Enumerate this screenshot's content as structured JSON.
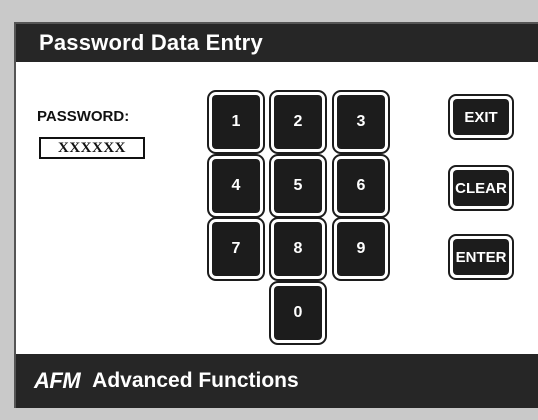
{
  "title": "Password Data Entry",
  "password": {
    "label": "PASSWORD:",
    "value": "XXXXXX"
  },
  "keypad": {
    "k1": "1",
    "k2": "2",
    "k3": "3",
    "k4": "4",
    "k5": "5",
    "k6": "6",
    "k7": "7",
    "k8": "8",
    "k9": "9",
    "k0": "0"
  },
  "actions": {
    "exit": "EXIT",
    "clear": "CLEAR",
    "enter": "ENTER"
  },
  "footer": {
    "logo": "AFM",
    "name": "Advanced Functions"
  }
}
